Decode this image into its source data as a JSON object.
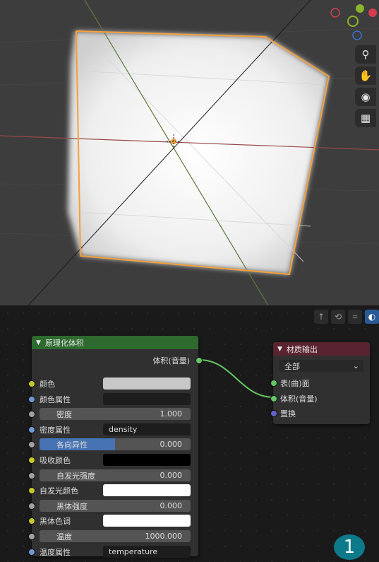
{
  "viewport": {
    "nav_icons": [
      "zoom-icon",
      "hand-icon",
      "camera-icon",
      "grid-icon"
    ],
    "nav_glyphs": [
      "⚲",
      "✋",
      "◉",
      "▦"
    ]
  },
  "node_editor": {
    "toolbar_glyphs": [
      "↑",
      "⟲",
      "⌗",
      "◐"
    ],
    "principled_volume": {
      "title": "原理化体积",
      "output_label": "体积(音量)",
      "inputs": [
        {
          "label": "颜色",
          "socket": "yellow",
          "kind": "color",
          "color": "#c8c8c8"
        },
        {
          "label": "颜色属性",
          "socket": "blue",
          "kind": "text",
          "value": ""
        },
        {
          "label": "密度",
          "socket": "gray",
          "kind": "num",
          "value": "1.000"
        },
        {
          "label": "密度属性",
          "socket": "blue",
          "kind": "text",
          "value": "density"
        },
        {
          "label": "各向异性",
          "socket": "gray",
          "kind": "slider",
          "value": "0.000",
          "fill": 0.5
        },
        {
          "label": "吸收颜色",
          "socket": "yellow",
          "kind": "color",
          "color": "#000000"
        },
        {
          "label": "自发光强度",
          "socket": "gray",
          "kind": "num",
          "value": "0.000"
        },
        {
          "label": "自发光颜色",
          "socket": "yellow",
          "kind": "color",
          "color": "#ffffff"
        },
        {
          "label": "黑体强度",
          "socket": "gray",
          "kind": "num",
          "value": "0.000"
        },
        {
          "label": "黑体色调",
          "socket": "yellow",
          "kind": "color",
          "color": "#ffffff"
        },
        {
          "label": "温度",
          "socket": "gray",
          "kind": "num",
          "value": "1000.000"
        },
        {
          "label": "温度属性",
          "socket": "blue",
          "kind": "text",
          "value": "temperature"
        }
      ]
    },
    "material_output": {
      "title": "材质输出",
      "target": "全部",
      "inputs": [
        {
          "label": "表(曲)面",
          "socket": "green"
        },
        {
          "label": "体积(音量)",
          "socket": "green"
        },
        {
          "label": "置换",
          "socket": "purple"
        }
      ]
    }
  },
  "badge": "1",
  "colors": {
    "accent_orange": "#f5a03a",
    "node_green_header": "#2e6a2e",
    "node_red_header": "#5a2330",
    "slider_blue": "#4772b3"
  }
}
